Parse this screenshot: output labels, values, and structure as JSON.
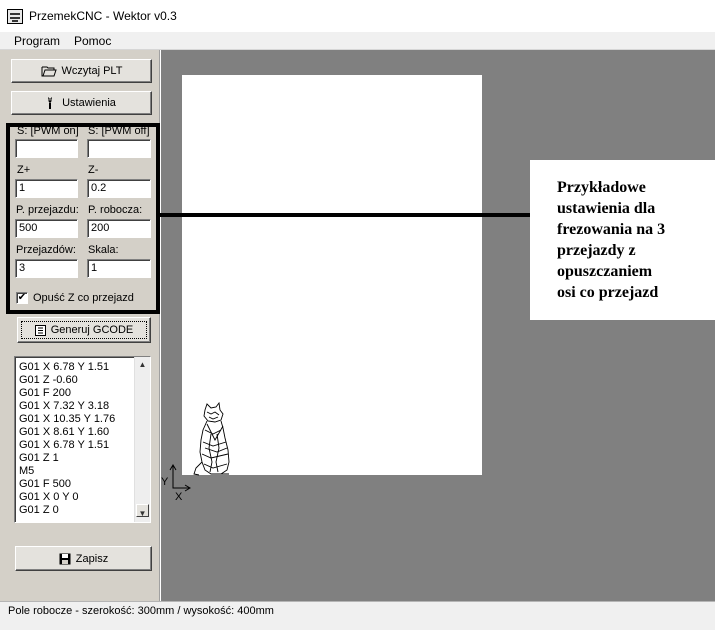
{
  "window": {
    "title": "PrzemekCNC - Wektor v0.3"
  },
  "menu": {
    "items": [
      "Program",
      "Pomoc"
    ]
  },
  "buttons": {
    "load_plt": {
      "label": "Wczytaj PLT",
      "icon": "folder-open-icon"
    },
    "settings": {
      "label": "Ustawienia",
      "icon": "wrench-icon"
    },
    "generate": {
      "label": "Generuj GCODE",
      "icon": "document-icon"
    },
    "save": {
      "label": "Zapisz",
      "icon": "floppy-disk-icon"
    }
  },
  "settings": {
    "s_pwm_on": {
      "label": "S: [PWM on]",
      "value": ""
    },
    "s_pwm_off": {
      "label": "S: [PWM off]",
      "value": ""
    },
    "z_plus": {
      "label": "Z+",
      "value": "1"
    },
    "z_minus": {
      "label": "Z-",
      "value": "0.2"
    },
    "travel_speed": {
      "label": "P. przejazdu:",
      "value": "500"
    },
    "work_speed": {
      "label": "P. robocza:",
      "value": "200"
    },
    "passes": {
      "label": "Przejazdów:",
      "value": "3"
    },
    "scale": {
      "label": "Skala:",
      "value": "1"
    },
    "lower_z": {
      "label": "Opuść Z co przejazd",
      "checked": true,
      "check_mark": "✔"
    }
  },
  "gcode": {
    "lines": [
      "G01 X 6.78 Y 1.51",
      "G01 Z -0.60",
      "G01 F 200",
      "G01 X 7.32 Y 3.18",
      "G01 X 10.35 Y 1.76",
      "G01 X 8.61 Y 1.60",
      "G01 X 6.78 Y 1.51",
      "G01 Z 1",
      "M5",
      "G01 F 500",
      "G01 X 0 Y 0",
      "G01 Z 0"
    ],
    "scroll_up": "▲",
    "scroll_down": "▼"
  },
  "workspace": {
    "axis_y_label": "Y",
    "axis_x_label": "X",
    "colors": {
      "background": "#808080",
      "sheet": "#ffffff"
    }
  },
  "annotation": {
    "lines": [
      "Przykładowe",
      "ustawienia dla",
      "frezowania na 3",
      "przejazdy z",
      "opuszczaniem",
      "osi co przejazd"
    ]
  },
  "status": {
    "text": "Pole robocze - szerokość: 300mm / wysokość: 400mm"
  }
}
